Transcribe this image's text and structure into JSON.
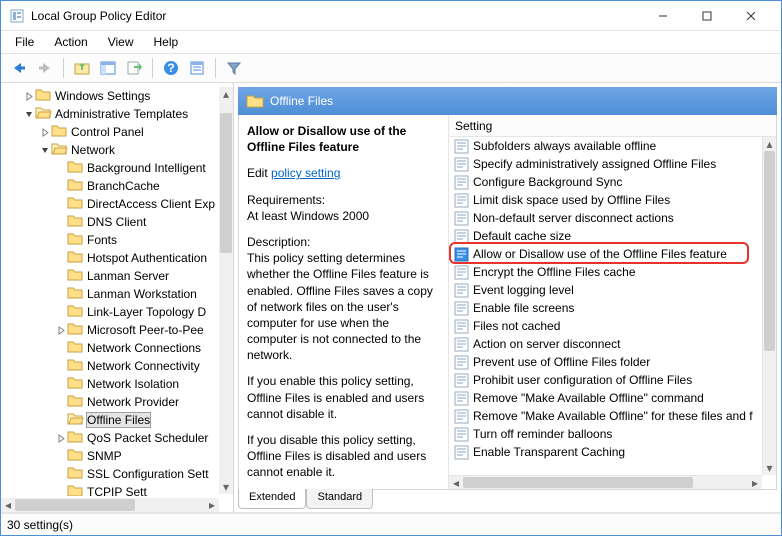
{
  "window": {
    "title": "Local Group Policy Editor"
  },
  "menu": {
    "file": "File",
    "action": "Action",
    "view": "View",
    "help": "Help"
  },
  "tree": {
    "items": [
      {
        "indent": 1,
        "chevron": "right",
        "label": "Windows Settings"
      },
      {
        "indent": 1,
        "chevron": "down",
        "label": "Administrative Templates"
      },
      {
        "indent": 2,
        "chevron": "right",
        "label": "Control Panel"
      },
      {
        "indent": 2,
        "chevron": "down",
        "label": "Network"
      },
      {
        "indent": 3,
        "chevron": "",
        "label": "Background Intelligent"
      },
      {
        "indent": 3,
        "chevron": "",
        "label": "BranchCache"
      },
      {
        "indent": 3,
        "chevron": "",
        "label": "DirectAccess Client Exp"
      },
      {
        "indent": 3,
        "chevron": "",
        "label": "DNS Client"
      },
      {
        "indent": 3,
        "chevron": "",
        "label": "Fonts"
      },
      {
        "indent": 3,
        "chevron": "",
        "label": "Hotspot Authentication"
      },
      {
        "indent": 3,
        "chevron": "",
        "label": "Lanman Server"
      },
      {
        "indent": 3,
        "chevron": "",
        "label": "Lanman Workstation"
      },
      {
        "indent": 3,
        "chevron": "",
        "label": "Link-Layer Topology D"
      },
      {
        "indent": 3,
        "chevron": "right",
        "label": "Microsoft Peer-to-Pee"
      },
      {
        "indent": 3,
        "chevron": "",
        "label": "Network Connections"
      },
      {
        "indent": 3,
        "chevron": "",
        "label": "Network Connectivity"
      },
      {
        "indent": 3,
        "chevron": "",
        "label": "Network Isolation"
      },
      {
        "indent": 3,
        "chevron": "",
        "label": "Network Provider"
      },
      {
        "indent": 3,
        "chevron": "",
        "label": "Offline Files",
        "selected": true
      },
      {
        "indent": 3,
        "chevron": "right",
        "label": "QoS Packet Scheduler"
      },
      {
        "indent": 3,
        "chevron": "",
        "label": "SNMP"
      },
      {
        "indent": 3,
        "chevron": "",
        "label": "SSL Configuration Sett"
      },
      {
        "indent": 3,
        "chevron": "",
        "label": "TCPIP Sett"
      }
    ]
  },
  "details": {
    "header": "Offline Files",
    "desc_title": "Allow or Disallow use of the Offline Files feature",
    "edit_prefix": "Edit ",
    "edit_link": "policy setting",
    "requirements_h": "Requirements:",
    "requirements": "At least Windows 2000",
    "description_h": "Description:",
    "description_p1": "This policy setting determines whether the Offline Files feature is enabled. Offline Files saves a copy of network files on the user's computer for use when the computer is not connected to the network.",
    "description_p2": "If you enable this policy setting, Offline Files is enabled and users cannot disable it.",
    "description_p3": "If you disable this policy setting, Offline Files is disabled and users cannot enable it."
  },
  "settings": {
    "header": "Setting",
    "items": [
      "Subfolders always available offline",
      "Specify administratively assigned Offline Files",
      "Configure Background Sync",
      "Limit disk space used by Offline Files",
      "Non-default server disconnect actions",
      "Default cache size",
      "Allow or Disallow use of the Offline Files feature",
      "Encrypt the Offline Files cache",
      "Event logging level",
      "Enable file screens",
      "Files not cached",
      "Action on server disconnect",
      "Prevent use of Offline Files folder",
      "Prohibit user configuration of Offline Files",
      "Remove \"Make Available Offline\" command",
      "Remove \"Make Available Offline\" for these files and f",
      "Turn off reminder balloons",
      "Enable Transparent Caching"
    ],
    "highlighted_index": 6
  },
  "tabs": {
    "extended": "Extended",
    "standard": "Standard"
  },
  "status": "30 setting(s)"
}
